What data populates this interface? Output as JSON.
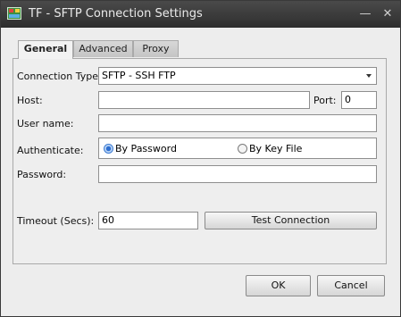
{
  "window": {
    "title": "TF - SFTP Connection Settings"
  },
  "tabs": [
    {
      "label": "General"
    },
    {
      "label": "Advanced"
    },
    {
      "label": "Proxy"
    }
  ],
  "form": {
    "connection_type_label": "Connection Type:",
    "connection_type_value": "SFTP - SSH FTP",
    "host_label": "Host:",
    "host_value": "",
    "port_label": "Port:",
    "port_value": "0",
    "username_label": "User name:",
    "username_value": "",
    "authenticate_label": "Authenticate:",
    "auth_options": [
      {
        "label": "By Password",
        "selected": true
      },
      {
        "label": "By Key File",
        "selected": false
      }
    ],
    "password_label": "Password:",
    "password_value": "",
    "timeout_label": "Timeout (Secs):",
    "timeout_value": "60",
    "test_button_label": "Test Connection"
  },
  "footer": {
    "ok_label": "OK",
    "cancel_label": "Cancel"
  }
}
